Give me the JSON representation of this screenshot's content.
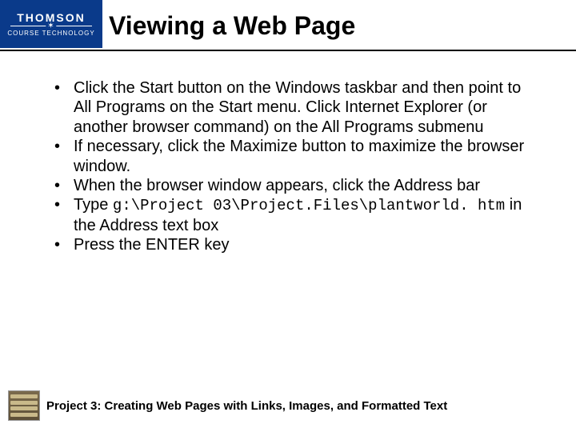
{
  "logo": {
    "top": "THOMSON",
    "bottom": "COURSE TECHNOLOGY"
  },
  "title": "Viewing a Web Page",
  "bullets": [
    {
      "text": "Click the Start button on the Windows taskbar and then point to All Programs on the Start menu. Click Internet Explorer (or another browser command) on the All Programs submenu"
    },
    {
      "text": "If necessary, click the Maximize button to maximize the browser window."
    },
    {
      "text": "When the browser window appears, click the Address bar"
    },
    {
      "prefix": "Type ",
      "code": "g:\\Project 03\\Project.Files\\plantworld. htm",
      "suffix": " in the Address text box"
    },
    {
      "text": "Press the ENTER key"
    }
  ],
  "footer": "Project 3: Creating Web Pages with Links, Images, and Formatted Text"
}
